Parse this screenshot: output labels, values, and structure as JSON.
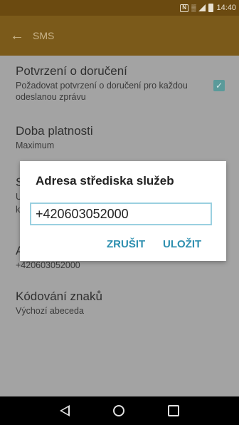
{
  "status_bar": {
    "time": "14:40",
    "icons": [
      "nfc-icon",
      "sim-icon",
      "signal-icon",
      "battery-icon"
    ]
  },
  "app_bar": {
    "title": "SMS",
    "back_icon": "arrow-left-icon"
  },
  "settings": [
    {
      "title": "Potvrzení o doručení",
      "summary": "Požadovat potvrzení o doručení pro každou odeslanou zprávu",
      "checked": true
    },
    {
      "title": "Doba platnosti",
      "summary": "Maximum"
    },
    {
      "title": "S",
      "summary_line1": "U",
      "summary_line2": "k"
    },
    {
      "title": "A",
      "summary": "+420603052000"
    },
    {
      "title": "Kódování znaků",
      "summary": "Výchozí abeceda"
    }
  ],
  "dialog": {
    "title": "Adresa střediska služeb",
    "input_value": "+420603052000",
    "cancel_label": "ZRUŠIT",
    "save_label": "ULOŽIT"
  },
  "nav_bar": {
    "icons": [
      "back-icon",
      "home-icon",
      "recents-icon"
    ]
  }
}
